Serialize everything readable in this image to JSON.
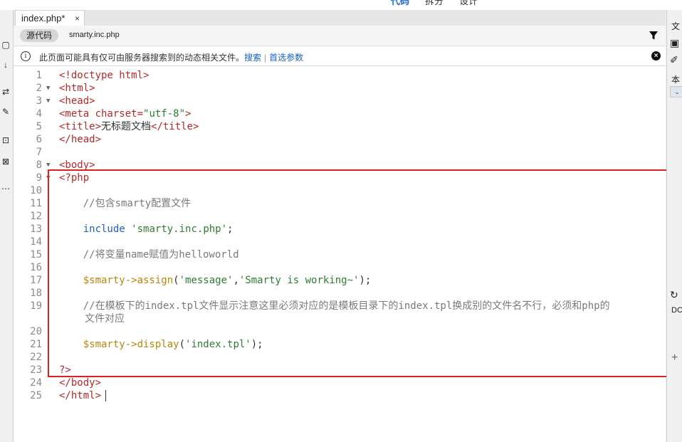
{
  "top_menu": [
    "代码",
    "拆分",
    "设计"
  ],
  "document_tab": {
    "label": "index.php*",
    "close": "×"
  },
  "source_bar": {
    "source_button": "源代码",
    "related_file": "smarty.inc.php"
  },
  "info_bar": {
    "message": "此页面可能具有仅可由服务器搜索到的动态相关文件。",
    "search_link": "搜索",
    "separator": "|",
    "prefs_link": "首选参数",
    "close": "×"
  },
  "code": {
    "lines": [
      {
        "n": "1",
        "fold": "",
        "text": "<!doctype html>"
      },
      {
        "n": "2",
        "fold": "▼",
        "text": "<html>"
      },
      {
        "n": "3",
        "fold": "▼",
        "text": "<head>"
      },
      {
        "n": "4",
        "fold": "",
        "text": "<meta charset=\"utf-8\">"
      },
      {
        "n": "5",
        "fold": "",
        "text": "<title>无标题文档</title>"
      },
      {
        "n": "6",
        "fold": "",
        "text": "</head>"
      },
      {
        "n": "7",
        "fold": "",
        "text": ""
      },
      {
        "n": "8",
        "fold": "▼",
        "text": "<body>"
      },
      {
        "n": "9",
        "fold": "▼",
        "text": "<?php"
      },
      {
        "n": "10",
        "fold": "",
        "text": ""
      },
      {
        "n": "11",
        "fold": "",
        "text": "    //包含smarty配置文件"
      },
      {
        "n": "12",
        "fold": "",
        "text": ""
      },
      {
        "n": "13",
        "fold": "",
        "text": "    include 'smarty.inc.php';"
      },
      {
        "n": "14",
        "fold": "",
        "text": ""
      },
      {
        "n": "15",
        "fold": "",
        "text": "    //将变量name赋值为helloworld"
      },
      {
        "n": "16",
        "fold": "",
        "text": ""
      },
      {
        "n": "17",
        "fold": "",
        "text": "    $smarty->assign('message','Smarty is working~');"
      },
      {
        "n": "18",
        "fold": "",
        "text": ""
      },
      {
        "n": "19",
        "fold": "",
        "text": "    //在模板下的index.tpl文件显示注意这里必须对应的是模板目录下的index.tpl换成别的文件名不行，必须和php的",
        "wrap": "文件对应"
      },
      {
        "n": "20",
        "fold": "",
        "text": ""
      },
      {
        "n": "21",
        "fold": "",
        "text": "    $smarty->display('index.tpl');"
      },
      {
        "n": "22",
        "fold": "",
        "text": ""
      },
      {
        "n": "23",
        "fold": "",
        "text": "?>"
      },
      {
        "n": "24",
        "fold": "",
        "text": "</body>"
      },
      {
        "n": "25",
        "fold": "",
        "text": "</html>"
      }
    ]
  },
  "right_panel": {
    "item1": "文",
    "item2": "本",
    "item3": "DC",
    "add": "+"
  },
  "colors": {
    "highlight_border": "#e02020",
    "link": "#1a5fc0",
    "tag": "#b22a2a",
    "string": "#2e7d32",
    "keyword": "#1f5fbf",
    "variable": "#b8860b"
  }
}
